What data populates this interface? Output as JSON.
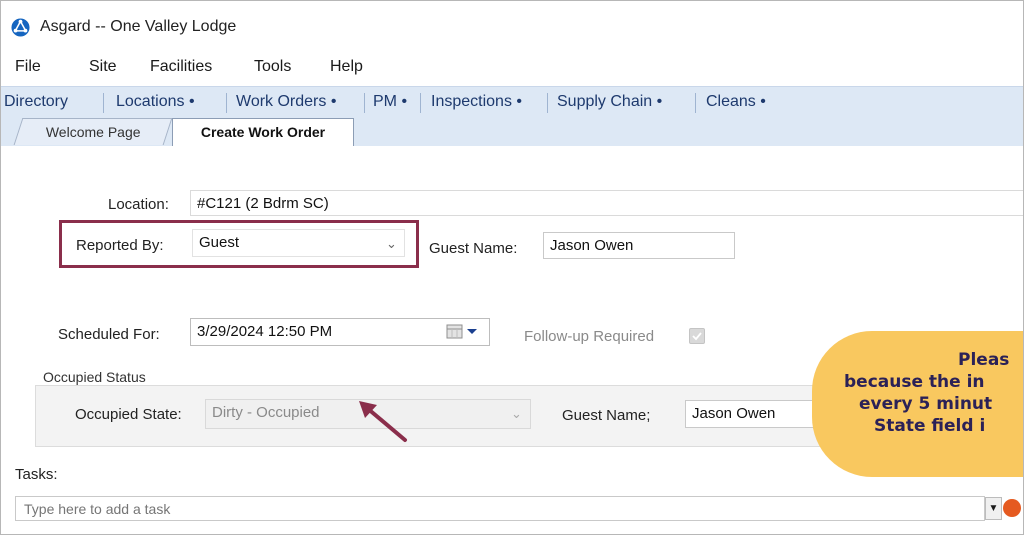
{
  "window": {
    "title": "Asgard -- One Valley Lodge"
  },
  "menu": [
    "File",
    "Site",
    "Facilities",
    "Tools",
    "Help"
  ],
  "nav": [
    {
      "label": "Directory"
    },
    {
      "label": "Locations •"
    },
    {
      "label": "Work Orders •"
    },
    {
      "label": "PM •"
    },
    {
      "label": "Inspections •"
    },
    {
      "label": "Supply Chain •"
    },
    {
      "label": "Cleans •"
    }
  ],
  "tabs": {
    "welcome": "Welcome Page",
    "create": "Create Work Order"
  },
  "form": {
    "location_label": "Location:",
    "location_value": "#C121 (2 Bdrm SC)",
    "reported_by_label": "Reported By:",
    "reported_by_value": "Guest",
    "guest_name_label": "Guest Name:",
    "guest_name_value": "Jason Owen",
    "scheduled_label": "Scheduled For:",
    "scheduled_value": "3/29/2024 12:50 PM",
    "followup_label": "Follow-up Required",
    "occupied_group_label": "Occupied Status",
    "occupied_state_label": "Occupied State:",
    "occupied_state_value": "Dirty - Occupied",
    "guest_name2_label": "Guest Name;",
    "guest_name2_value": "Jason Owen",
    "tasks_label": "Tasks:",
    "tasks_placeholder": "Type here to add a task"
  },
  "callout": {
    "line1": "Pleas",
    "line2": "because the in",
    "line3": "every 5 minut",
    "line4": "State field i"
  },
  "colors": {
    "highlight": "#8a2e4b",
    "callout_bg": "#f9c85f",
    "callout_text": "#2b2157",
    "nav_bg": "#dde8f5"
  },
  "icons": {
    "app": "asgard-logo-icon",
    "calendar": "calendar-icon",
    "chevron": "chevron-down-icon",
    "clear": "clear-icon",
    "arrow": "pointer-arrow-icon"
  }
}
